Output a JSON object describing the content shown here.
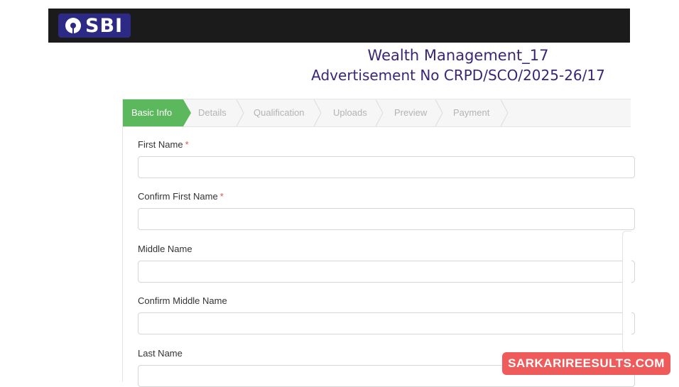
{
  "header": {
    "logo_text": "SBI",
    "brand_color": "#2d2a86"
  },
  "title": {
    "line1": "Wealth Management_17",
    "line2": "Advertisement No CRPD/SCO/2025-26/17"
  },
  "steps": [
    {
      "label": "Basic Info",
      "active": true
    },
    {
      "label": "Details",
      "active": false
    },
    {
      "label": "Qualification",
      "active": false
    },
    {
      "label": "Uploads",
      "active": false
    },
    {
      "label": "Preview",
      "active": false
    },
    {
      "label": "Payment",
      "active": false
    }
  ],
  "form": {
    "first_name_label": "First Name",
    "first_name_required": "*",
    "first_name_value": "",
    "confirm_first_name_label": "Confirm First Name",
    "confirm_first_name_required": "*",
    "confirm_first_name_value": "",
    "middle_name_label": "Middle Name",
    "middle_name_value": "",
    "confirm_middle_name_label": "Confirm Middle Name",
    "confirm_middle_name_value": "",
    "last_name_label": "Last Name",
    "last_name_value": ""
  },
  "watermark": {
    "text": "SARKARIREESULTS.COM",
    "color": "#ef5b5b"
  },
  "colors": {
    "active_step": "#5cb85c",
    "title_text": "#3a2675",
    "required_mark": "#d9534f"
  }
}
